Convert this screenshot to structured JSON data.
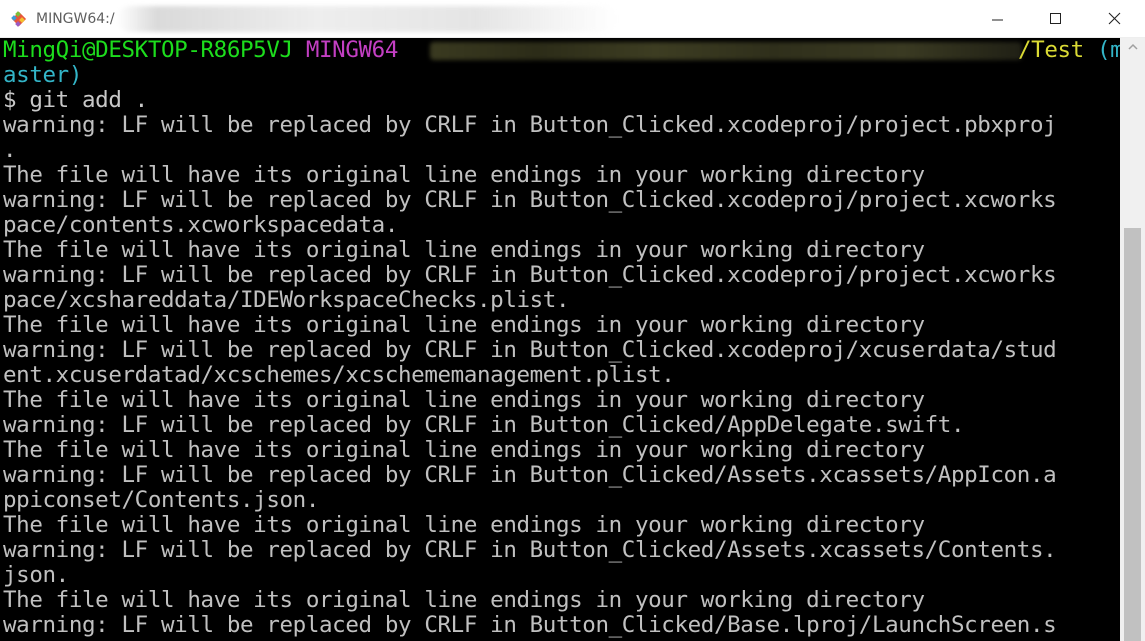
{
  "window": {
    "title": "MINGW64:/"
  },
  "icons": {
    "app": "git-for-windows-icon",
    "minimize": "minimize-icon",
    "maximize": "maximize-icon",
    "close": "close-icon",
    "scroll_up": "chevron-up-icon"
  },
  "colors": {
    "background": "#000000",
    "text": "#c0c0c0",
    "prompt_user": "#1ddd1d",
    "prompt_env": "#c33fc3",
    "prompt_path": "#dada34",
    "prompt_branch": "#33b5c8"
  },
  "terminal": {
    "prompt": {
      "user_host": "MingQi@DESKTOP-R86P5VJ",
      "env": "MINGW64",
      "path_tail": "/Test",
      "branch_open": "(m",
      "branch_close": "aster)"
    },
    "command": "$ git add .",
    "output": [
      "warning: LF will be replaced by CRLF in Button_Clicked.xcodeproj/project.pbxproj",
      ".",
      "The file will have its original line endings in your working directory",
      "warning: LF will be replaced by CRLF in Button_Clicked.xcodeproj/project.xcworks",
      "pace/contents.xcworkspacedata.",
      "The file will have its original line endings in your working directory",
      "warning: LF will be replaced by CRLF in Button_Clicked.xcodeproj/project.xcworks",
      "pace/xcshareddata/IDEWorkspaceChecks.plist.",
      "The file will have its original line endings in your working directory",
      "warning: LF will be replaced by CRLF in Button_Clicked.xcodeproj/xcuserdata/stud",
      "ent.xcuserdatad/xcschemes/xcschememanagement.plist.",
      "The file will have its original line endings in your working directory",
      "warning: LF will be replaced by CRLF in Button_Clicked/AppDelegate.swift.",
      "The file will have its original line endings in your working directory",
      "warning: LF will be replaced by CRLF in Button_Clicked/Assets.xcassets/AppIcon.a",
      "ppiconset/Contents.json.",
      "The file will have its original line endings in your working directory",
      "warning: LF will be replaced by CRLF in Button_Clicked/Assets.xcassets/Contents.",
      "json.",
      "The file will have its original line endings in your working directory",
      "warning: LF will be replaced by CRLF in Button_Clicked/Base.lproj/LaunchScreen.s"
    ]
  }
}
